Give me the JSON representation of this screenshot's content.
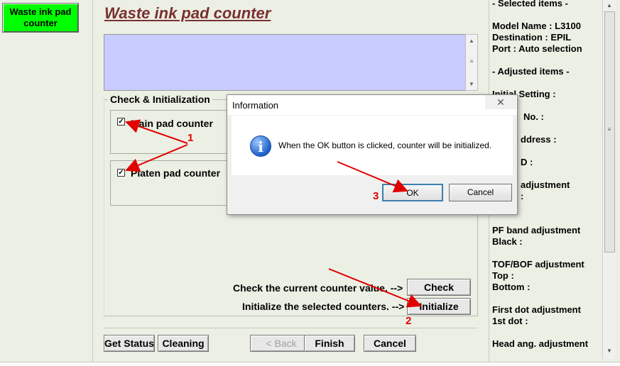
{
  "sidebar": {
    "waste_button": "Waste ink pad\ncounter"
  },
  "main": {
    "title": "Waste ink pad counter",
    "group_label": "Check & Initialization",
    "main_pad": {
      "label": "Main pad counter",
      "checked": true
    },
    "platen_pad": {
      "label": "Platen pad counter",
      "checked": true
    },
    "check_text": "Check the current counter value. -->",
    "check_button": "Check",
    "init_text": "Initialize the selected counters. -->",
    "init_button": "Initialize"
  },
  "footer": {
    "get_status": "Get Status",
    "cleaning": "Cleaning",
    "back": "< Back",
    "finish": "Finish",
    "cancel": "Cancel"
  },
  "right_panel": {
    "lines": [
      "- Selected items -",
      "Model Name : L3100",
      "Destination : EPIL",
      "Port : Auto selection",
      "- Adjusted items -",
      "Initial Setting :",
      "No. :",
      "ddress :",
      "D :",
      "adjustment",
      ":",
      "PF band adjustment",
      " Black :",
      "TOF/BOF adjustment",
      " Top :",
      " Bottom :",
      "First dot adjustment",
      " 1st dot :",
      "Head ang. adjustment"
    ]
  },
  "dialog": {
    "title": "Information",
    "close_glyph": "✕",
    "icon": "info-icon",
    "message": "When the OK button is clicked, counter will be initialized.",
    "ok": "OK",
    "cancel": "Cancel"
  },
  "annotations": {
    "num1": "1",
    "num2": "2",
    "num3": "3",
    "color": "#e00000"
  }
}
